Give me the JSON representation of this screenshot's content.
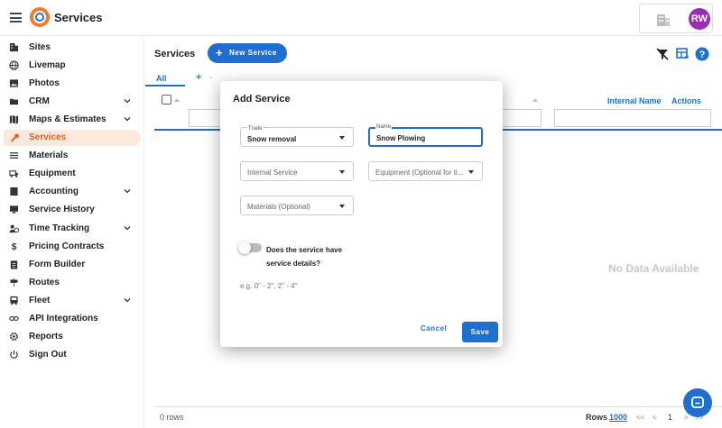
{
  "app": {
    "title": "Services",
    "avatar_initials": "RW",
    "brand_color": "#e25f1f",
    "accent_color": "#1e6fd0",
    "avatar_color": "#9b2cb5"
  },
  "sidebar": {
    "items": [
      {
        "label": "Sites",
        "icon": "building-icon",
        "active": false,
        "expandable": false
      },
      {
        "label": "Livemap",
        "icon": "globe-icon",
        "active": false,
        "expandable": false
      },
      {
        "label": "Photos",
        "icon": "image-icon",
        "active": false,
        "expandable": false
      },
      {
        "label": "CRM",
        "icon": "folder-icon",
        "active": false,
        "expandable": true
      },
      {
        "label": "Maps & Estimates",
        "icon": "map-icon",
        "active": false,
        "expandable": true
      },
      {
        "label": "Services",
        "icon": "wrench-icon",
        "active": true,
        "expandable": false
      },
      {
        "label": "Materials",
        "icon": "layers-icon",
        "active": false,
        "expandable": false
      },
      {
        "label": "Equipment",
        "icon": "truck-icon",
        "active": false,
        "expandable": false
      },
      {
        "label": "Accounting",
        "icon": "book-icon",
        "active": false,
        "expandable": true
      },
      {
        "label": "Service History",
        "icon": "monitor-icon",
        "active": false,
        "expandable": false
      },
      {
        "label": "Time Tracking",
        "icon": "clock-user-icon",
        "active": false,
        "expandable": true
      },
      {
        "label": "Pricing Contracts",
        "icon": "dollar-icon",
        "active": false,
        "expandable": false
      },
      {
        "label": "Form Builder",
        "icon": "clipboard-icon",
        "active": false,
        "expandable": false
      },
      {
        "label": "Routes",
        "icon": "signpost-icon",
        "active": false,
        "expandable": false
      },
      {
        "label": "Fleet",
        "icon": "bus-icon",
        "active": false,
        "expandable": true
      },
      {
        "label": "API Integrations",
        "icon": "link-icon",
        "active": false,
        "expandable": false
      },
      {
        "label": "Reports",
        "icon": "gear-icon",
        "active": false,
        "expandable": false
      },
      {
        "label": "Sign Out",
        "icon": "power-icon",
        "active": false,
        "expandable": false
      }
    ]
  },
  "main": {
    "page_title": "Services",
    "new_service_label": "New Service",
    "tabs": [
      {
        "label": "All"
      }
    ],
    "add_tab_label": "+",
    "tab_separator": "-",
    "columns": {
      "internal_name": "Internal Name",
      "actions": "Actions"
    },
    "empty_text": "No Data Available",
    "footer": {
      "rows_count": "0 rows",
      "rows_label": "Rows",
      "rows_value": "1000",
      "first": "<<",
      "prev": "<",
      "page": "1",
      "next": ">",
      "last": ">>"
    }
  },
  "modal": {
    "title": "Add Service",
    "trade": {
      "label": "Trade",
      "value": "Snow removal"
    },
    "name": {
      "label": "Name",
      "value": "Snow Plowing"
    },
    "internal_service": {
      "placeholder": "Internal Service"
    },
    "equipment": {
      "placeholder": "Equipment (Optional for ti..."
    },
    "materials": {
      "placeholder": "Materials (Optional)"
    },
    "toggle_label": "Does the service have service details?",
    "toggle_on": false,
    "hint": "e.g. 0\" - 2\", 2\" - 4\"",
    "cancel_label": "Cancel",
    "save_label": "Save"
  }
}
